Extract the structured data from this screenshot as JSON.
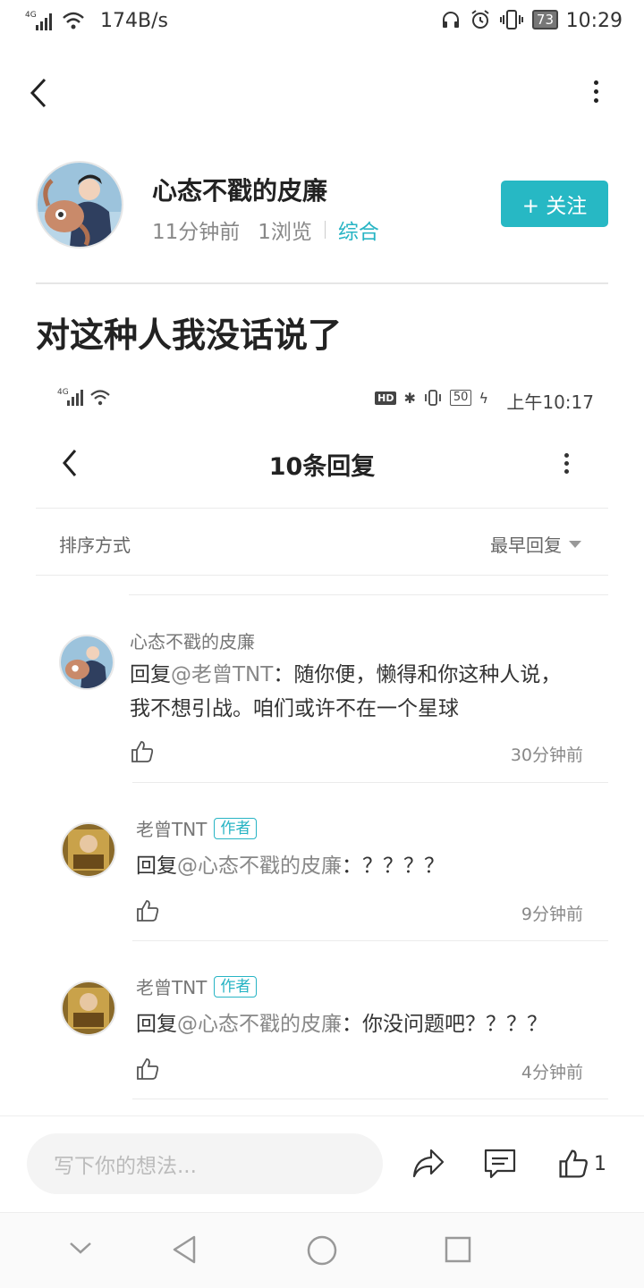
{
  "status_bar": {
    "signal": "4G",
    "speed": "174B/s",
    "battery": "73",
    "time": "10:29"
  },
  "post": {
    "author": "心态不戳的皮廉",
    "time_ago": "11分钟前",
    "views": "1浏览",
    "category": "综合",
    "follow_label": "+ 关注",
    "title": "对这种人我没话说了"
  },
  "embedded": {
    "status": {
      "signal": "4G",
      "battery": "50",
      "time": "上午10:17",
      "hd": "HD"
    },
    "header_title": "10条回复",
    "sort_label": "排序方式",
    "sort_value": "最早回复",
    "comments": [
      {
        "name": "心态不戳的皮廉",
        "tag": "",
        "prefix": "回复",
        "mention": "@老曾TNT",
        "text": "：随你便，懒得和你这种人说，我不想引战。咱们或许不在一个星球",
        "time": "30分钟前"
      },
      {
        "name": "老曾TNT",
        "tag": "作者",
        "prefix": "回复",
        "mention": "@心态不戳的皮廉",
        "text": "：？？？？",
        "time": "9分钟前"
      },
      {
        "name": "老曾TNT",
        "tag": "作者",
        "prefix": "回复",
        "mention": "@心态不戳的皮廉",
        "text": "：你没问题吧？？？？",
        "time": "4分钟前"
      }
    ]
  },
  "bottom": {
    "input_placeholder": "写下你的想法...",
    "like_count": "1"
  },
  "colors": {
    "accent": "#27b8c4"
  }
}
